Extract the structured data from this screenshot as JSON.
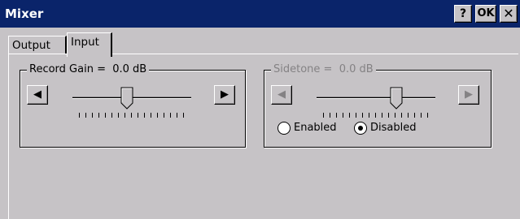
{
  "window": {
    "title": "Mixer",
    "buttons": {
      "help": "?",
      "ok": "OK",
      "close": "✕"
    }
  },
  "tabs": [
    {
      "label": "Output",
      "selected": false
    },
    {
      "label": "Input",
      "selected": true
    }
  ],
  "record_gain": {
    "label": "Record Gain =",
    "value": "0.0 dB",
    "left_arrow": "◀",
    "right_arrow": "▶",
    "slider_level": 0.45
  },
  "sidetone": {
    "label": "Sidetone =",
    "value": "0.0 dB",
    "left_arrow": "◀",
    "right_arrow": "▶",
    "slider_level": 0.69,
    "enabled_label": "Enabled",
    "disabled_label": "Disabled",
    "selected_option": "Disabled"
  },
  "colors": {
    "titlebar": "#0a246a",
    "face": "#c6c3c6",
    "disabled_text": "#848284"
  }
}
